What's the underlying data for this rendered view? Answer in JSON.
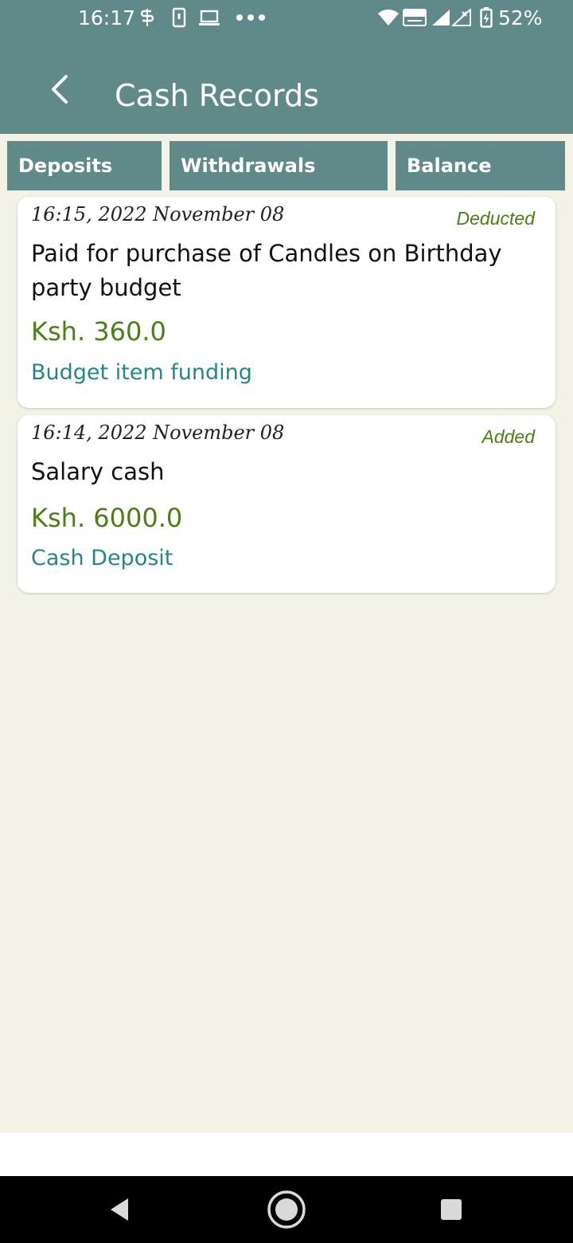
{
  "status_bar": {
    "time": "16:17",
    "battery_percent": "52%",
    "icons": [
      "sync-icon",
      "phone-screen-icon",
      "laptop-icon",
      "more-dots-icon",
      "wifi-icon",
      "volte-icon",
      "signal-icon",
      "signal-x-icon",
      "battery-charging-icon"
    ]
  },
  "header": {
    "title": "Cash Records",
    "back_icon": "back-arrow-icon"
  },
  "tabs": [
    {
      "label": "Deposits"
    },
    {
      "label": "Withdrawals"
    },
    {
      "label": "Balance"
    }
  ],
  "records": [
    {
      "datetime": "16:15, 2022 November 08",
      "status": "Deducted",
      "description": "Paid for purchase of Candles on Birthday party budget",
      "amount": "Ksh. 360.0",
      "category": "Budget item funding"
    },
    {
      "datetime": "16:14, 2022 November 08",
      "status": "Added",
      "description": "Salary cash",
      "amount": "Ksh. 6000.0",
      "category": "Cash Deposit"
    }
  ],
  "colors": {
    "primary": "#5f8a89",
    "background": "#f2f2e6",
    "amount_green": "#4a7f16",
    "category_teal": "#25868a"
  },
  "nav": {
    "icons": [
      "nav-back-icon",
      "nav-home-icon",
      "nav-recents-icon"
    ]
  }
}
